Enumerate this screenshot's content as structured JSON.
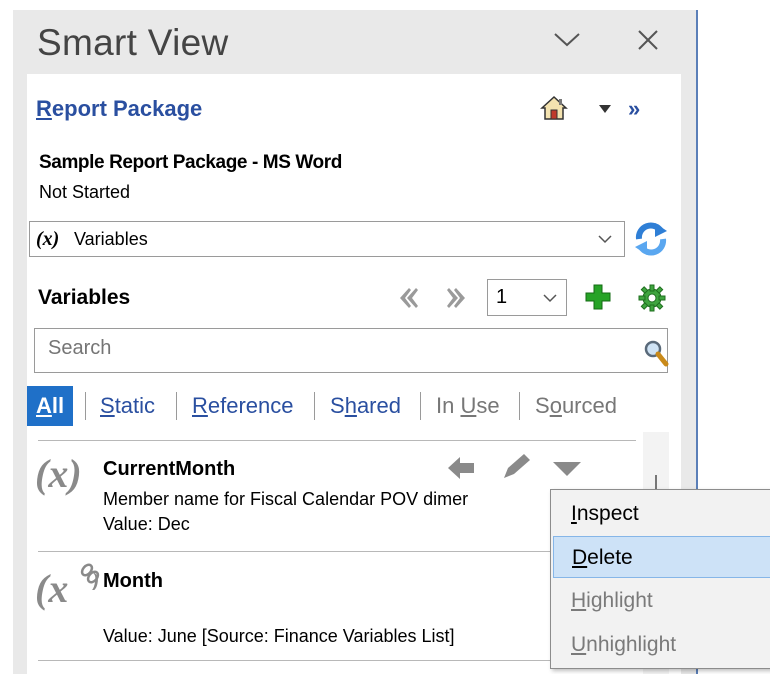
{
  "pane": {
    "title": "Smart View",
    "panel_link_prefix": "",
    "panel_link_u": "R",
    "panel_link_rest": "eport Package",
    "more_label": "»"
  },
  "package": {
    "name": "Sample Report Package - MS Word",
    "status": "Not Started"
  },
  "combo": {
    "icon_text": "(x)",
    "selected": "Variables"
  },
  "variables": {
    "heading": "Variables",
    "page": "1",
    "search_placeholder": "Search"
  },
  "filters": [
    {
      "pre": "",
      "u": "A",
      "post": "ll"
    },
    {
      "pre": "",
      "u": "S",
      "post": "tatic"
    },
    {
      "pre": "",
      "u": "R",
      "post": "eference"
    },
    {
      "pre": "S",
      "u": "h",
      "post": "ared"
    },
    {
      "pre": "In ",
      "u": "U",
      "post": "se"
    },
    {
      "pre": "S",
      "u": "o",
      "post": "urced"
    }
  ],
  "items": [
    {
      "icon_text": "(x)",
      "name": "CurrentMonth",
      "description": "Member name for Fiscal Calendar POV dimer",
      "value": "Value: Dec"
    },
    {
      "icon_text": "(x",
      "name": "Month",
      "value": "Value: June [Source: Finance Variables List]"
    }
  ],
  "context_menu": [
    {
      "u": "I",
      "rest": "nspect",
      "state": "normal"
    },
    {
      "u": "D",
      "rest": "elete",
      "state": "highlighted"
    },
    {
      "u": "H",
      "rest": "ighlight",
      "state": "disabled"
    },
    {
      "u": "U",
      "rest": "nhighlight",
      "state": "disabled"
    }
  ],
  "colors": {
    "accent": "#1f70c8",
    "link": "#2a4fa0",
    "add_green": "#27a327",
    "refresh_blue": "#2f7fd6"
  }
}
